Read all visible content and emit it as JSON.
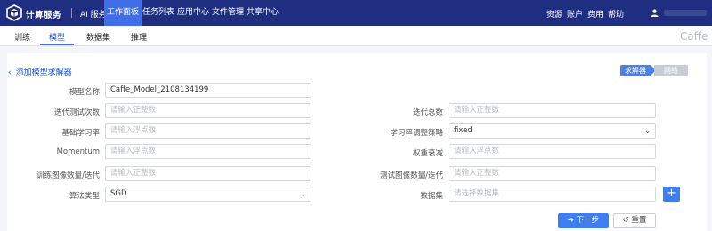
{
  "topbar": {
    "brand": "计算服务",
    "ai_service": "AI 服务",
    "tabs": [
      {
        "label": "工作面板"
      },
      {
        "label": "任务列表"
      },
      {
        "label": "应用中心"
      },
      {
        "label": "文件管理"
      },
      {
        "label": "共享中心"
      }
    ],
    "active_tab": "工作面板",
    "right_links": [
      "资源",
      "账户",
      "费用",
      "帮助"
    ]
  },
  "subtabs": {
    "items": [
      "训练",
      "模型",
      "数据集",
      "推理"
    ],
    "active": "模型"
  },
  "watermark": "Caffe",
  "form": {
    "back_label": "添加模型求解器",
    "steps": [
      "求解器",
      "网络"
    ],
    "fields": {
      "model_name": {
        "label": "模型名称",
        "value": "Caffe_Model_2108134199"
      },
      "test_iter": {
        "label": "迭代测试次数",
        "placeholder": "请输入正整数"
      },
      "total_iter": {
        "label": "迭代总数",
        "placeholder": "请输入正整数"
      },
      "base_lr": {
        "label": "基础学习率",
        "placeholder": "请输入浮点数"
      },
      "lr_policy": {
        "label": "学习率调整策略",
        "value": "fixed"
      },
      "momentum": {
        "label": "Momentum",
        "placeholder": "请输入浮点数"
      },
      "weight_decay": {
        "label": "权重衰减",
        "placeholder": "请输入浮点数"
      },
      "train_batch": {
        "label": "训练图像数量/迭代",
        "placeholder": "请输入正整数"
      },
      "test_batch": {
        "label": "测试图像数量/迭代",
        "placeholder": "请输入正整数"
      },
      "algorithm": {
        "label": "算法类型",
        "value": "SGD"
      },
      "dataset": {
        "label": "数据集",
        "placeholder": "请选择数据集"
      }
    },
    "plus_label": "+",
    "next_label": "下一步",
    "reset_label": "重置"
  },
  "colors": {
    "nav_bg": "#1f2e80",
    "accent": "#3f7ef0",
    "link": "#1e4fd1"
  }
}
